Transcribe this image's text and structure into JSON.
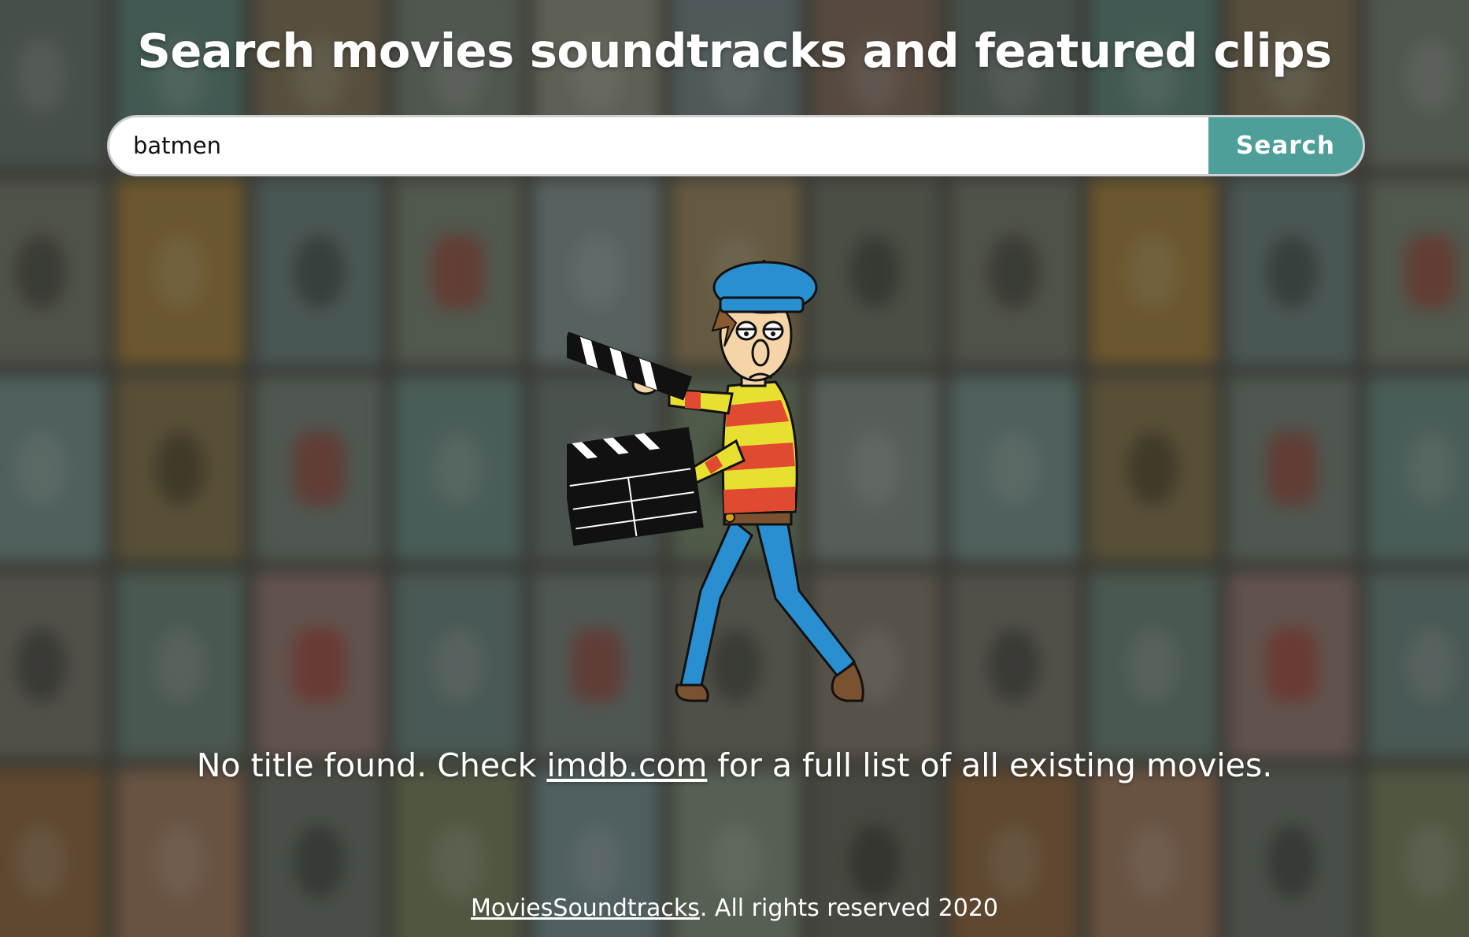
{
  "header": {
    "title": "Search movies soundtracks and featured clips"
  },
  "search": {
    "value": "batmen",
    "button_label": "Search"
  },
  "result": {
    "message_prefix": "No title found. Check ",
    "link_text": "imdb.com",
    "message_suffix": " for a full list of all existing movies."
  },
  "illustration": {
    "icon": "director-with-clapperboard-illustration"
  },
  "footer": {
    "brand_link": "MoviesSoundtracks",
    "rights_text": ". All rights reserved 2020"
  },
  "colors": {
    "accent": "#4e9e9a",
    "text": "#ffffff",
    "input_border": "#cfcfcf"
  }
}
